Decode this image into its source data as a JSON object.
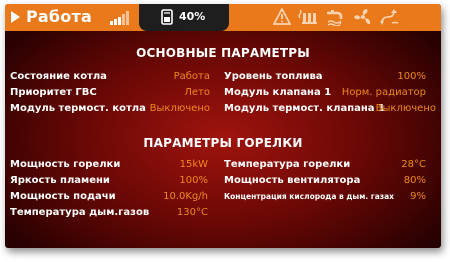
{
  "topbar": {
    "mode_label": "Работа",
    "fuel_level": "40%",
    "accent_color": "#e9791b",
    "icons": [
      "play-icon",
      "signal-bars-icon",
      "fuel-tank-icon",
      "warning-icon",
      "heater-icon",
      "hot-water-icon",
      "fan-icon",
      "circulation-icon"
    ]
  },
  "main_params": {
    "title": "ОСНОВНЫЕ ПАРАМЕТРЫ",
    "left": [
      {
        "label": "Состояние котла",
        "value": "Работа"
      },
      {
        "label": "Приоритет ГВС",
        "value": "Лето"
      },
      {
        "label": "Модуль термост. котла",
        "value": "Выключено"
      }
    ],
    "right": [
      {
        "label": "Уровень топлива",
        "value": "100%"
      },
      {
        "label": "Модуль клапана 1",
        "value": "Норм. радиатор"
      },
      {
        "label": "Модуль термост. клапана 1",
        "value": "Выключено"
      }
    ]
  },
  "burner_params": {
    "title": "ПАРАМЕТРЫ ГОРЕЛКИ",
    "left": [
      {
        "label": "Мощность горелки",
        "value": "15kW"
      },
      {
        "label": "Яркость пламени",
        "value": "100%"
      },
      {
        "label": "Мощность подачи",
        "value": "10.0Kg/h"
      },
      {
        "label": "Температура дым.газов",
        "value": "130°C"
      }
    ],
    "right": [
      {
        "label": "Температура горелки",
        "value": "28°C"
      },
      {
        "label": "Мощность вентилятора",
        "value": "80%"
      },
      {
        "label": "Концентрация кислорода в дым. газах",
        "value": "9%"
      }
    ]
  }
}
